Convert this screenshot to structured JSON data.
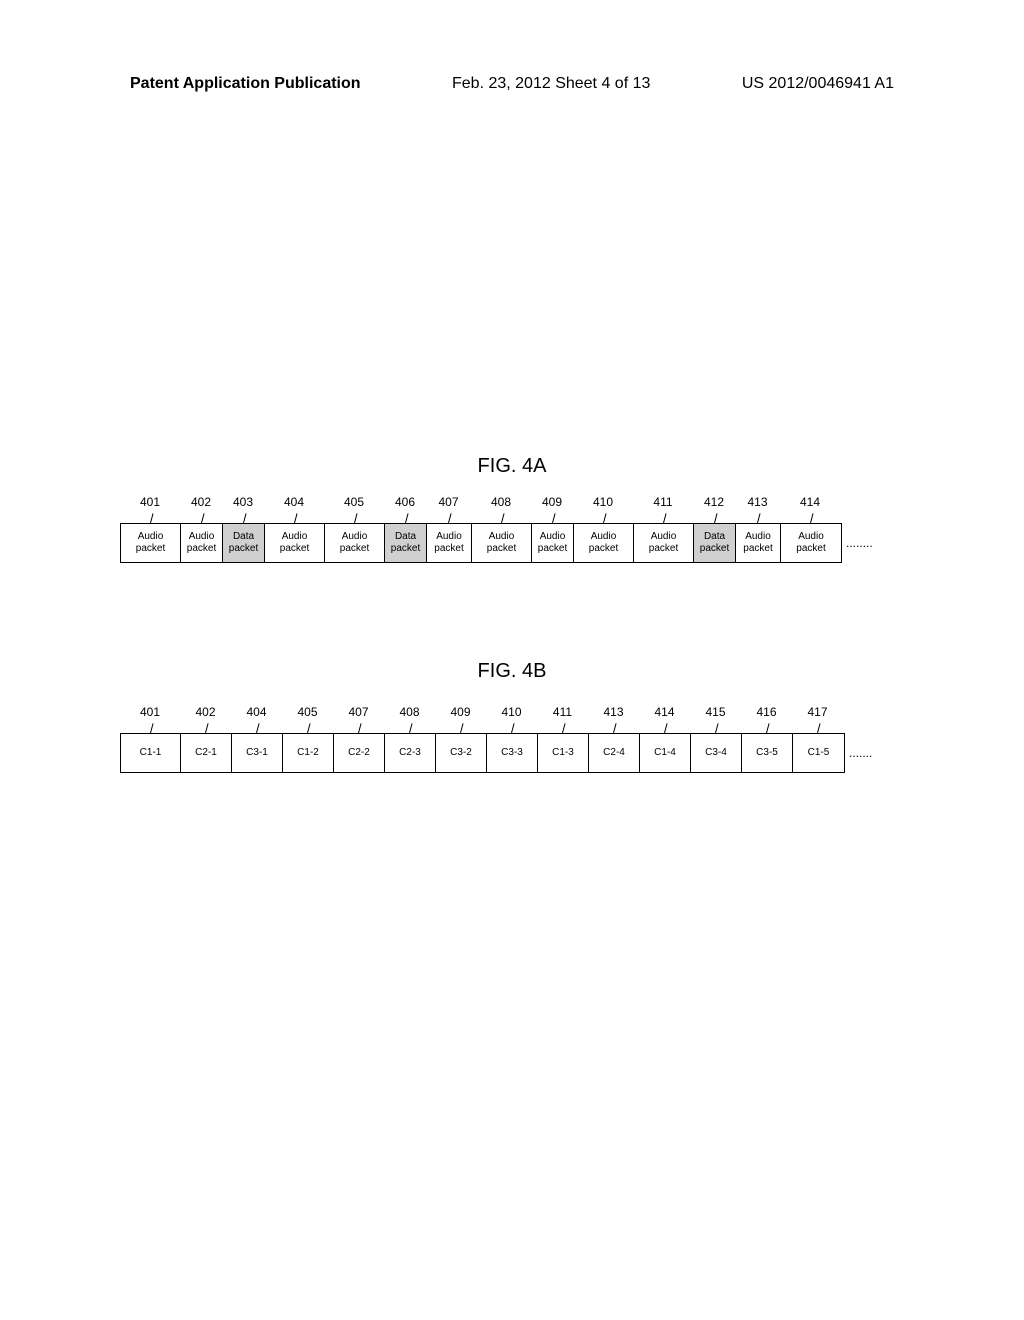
{
  "header": {
    "left": "Patent Application Publication",
    "center": "Feb. 23, 2012  Sheet 4 of 13",
    "right": "US 2012/0046941 A1"
  },
  "fig4a": {
    "label": "FIG. 4A",
    "refs": [
      "401",
      "402",
      "403",
      "404",
      "405",
      "406",
      "407",
      "408",
      "409",
      "410",
      "411",
      "412",
      "413",
      "414"
    ],
    "cells": [
      {
        "text": "Audio packet",
        "shaded": false
      },
      {
        "text": "Audio packet",
        "shaded": false
      },
      {
        "text": "Data packet",
        "shaded": true
      },
      {
        "text": "Audio packet",
        "shaded": false
      },
      {
        "text": "Audio packet",
        "shaded": false
      },
      {
        "text": "Data packet",
        "shaded": true
      },
      {
        "text": "Audio packet",
        "shaded": false
      },
      {
        "text": "Audio packet",
        "shaded": false
      },
      {
        "text": "Audio packet",
        "shaded": false
      },
      {
        "text": "Audio packet",
        "shaded": false
      },
      {
        "text": "Audio packet",
        "shaded": false
      },
      {
        "text": "Data packet",
        "shaded": true
      },
      {
        "text": "Audio packet",
        "shaded": false
      },
      {
        "text": "Audio packet",
        "shaded": false
      }
    ],
    "ellipsis": "........"
  },
  "fig4b": {
    "label": "FIG. 4B",
    "refs": [
      "401",
      "402",
      "404",
      "405",
      "407",
      "408",
      "409",
      "410",
      "411",
      "413",
      "414",
      "415",
      "416",
      "417"
    ],
    "cells": [
      "C1-1",
      "C2-1",
      "C3-1",
      "C1-2",
      "C2-2",
      "C2-3",
      "C3-2",
      "C3-3",
      "C1-3",
      "C2-4",
      "C1-4",
      "C3-4",
      "C3-5",
      "C1-5"
    ],
    "ellipsis": "......."
  }
}
